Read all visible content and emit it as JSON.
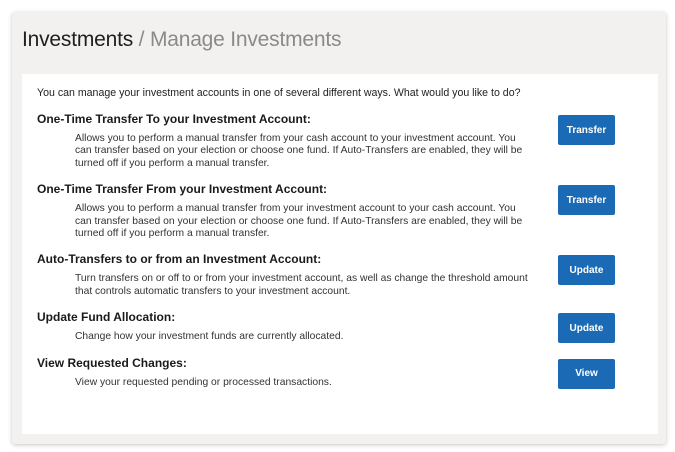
{
  "header": {
    "current": "Investments",
    "separator": "/",
    "page": "Manage Investments"
  },
  "intro": "You can manage your investment accounts in one of several different ways. What would you like to do?",
  "sections": [
    {
      "title": "One-Time Transfer To your Investment Account:",
      "description": "Allows you to perform a manual transfer from your cash account to your investment account. You can transfer based on your election or choose one fund. If Auto-Transfers are enabled, they will be turned off if you perform a manual transfer.",
      "button": "Transfer"
    },
    {
      "title": "One-Time Transfer From your Investment Account:",
      "description": "Allows you to perform a manual transfer from your investment account to your cash account. You can transfer based on your election or choose one fund. If Auto-Transfers are enabled, they will be turned off if you perform a manual transfer.",
      "button": "Transfer"
    },
    {
      "title": "Auto-Transfers to or from an Investment Account:",
      "description": "Turn transfers on or off to or from your investment account, as well as change the threshold amount that controls automatic transfers to your investment account.",
      "button": "Update"
    },
    {
      "title": "Update Fund Allocation:",
      "description": "Change how your investment funds are currently allocated.",
      "button": "Update"
    },
    {
      "title": "View Requested Changes:",
      "description": "View your requested pending or processed transactions.",
      "button": "View"
    }
  ],
  "colors": {
    "button_bg": "#1b6ab5",
    "panel_bg": "#f2f1ef",
    "content_bg": "#ffffff",
    "header_muted": "#8a8a8a"
  }
}
